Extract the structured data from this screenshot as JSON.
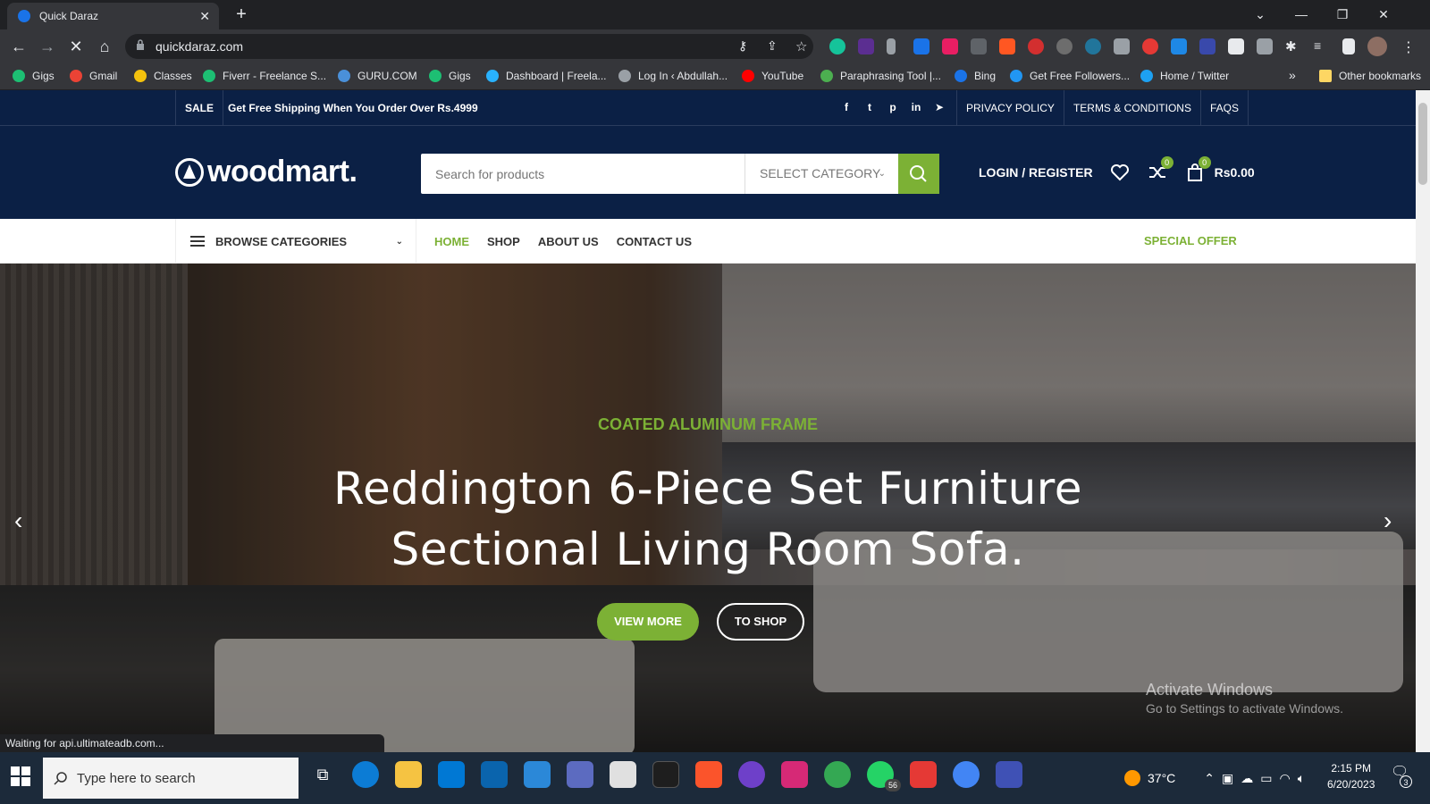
{
  "browser": {
    "tab_title": "Quick Daraz",
    "tab_close": "✕",
    "new_tab": "+",
    "url": "quickdaraz.com",
    "window_controls": [
      "⌄",
      "—",
      "❐",
      "✕"
    ],
    "nav": {
      "back": "←",
      "forward": "→",
      "reload": "✕",
      "home": "⌂"
    },
    "bookmarks": [
      {
        "label": "Gigs",
        "color": "#1dbf73"
      },
      {
        "label": "Gmail",
        "color": "#ea4335"
      },
      {
        "label": "Classes",
        "color": "#f4c20d"
      },
      {
        "label": "Fiverr - Freelance S...",
        "color": "#1dbf73"
      },
      {
        "label": "GURU.COM",
        "color": "#4a90d9"
      },
      {
        "label": "Gigs",
        "color": "#1dbf73"
      },
      {
        "label": "Dashboard | Freela...",
        "color": "#29b2fe"
      },
      {
        "label": "Log In ‹ Abdullah...",
        "color": "#9aa0a6"
      },
      {
        "label": "YouTube",
        "color": "#ff0000"
      },
      {
        "label": "Paraphrasing Tool |...",
        "color": "#4caf50"
      },
      {
        "label": "Bing",
        "color": "#1a73e8"
      },
      {
        "label": "Get Free Followers...",
        "color": "#2196f3"
      },
      {
        "label": "Home / Twitter",
        "color": "#1da1f2"
      }
    ],
    "bookmarks_more": "»",
    "other_bookmarks": "Other bookmarks",
    "status_text": "Waiting for api.ultimateadb.com..."
  },
  "site": {
    "topbar": {
      "sale_label": "SALE",
      "shipping_text": "Get Free Shipping When You Order Over Rs.4999",
      "social": [
        "f",
        "t",
        "p",
        "in",
        "➤"
      ],
      "links": [
        "PRIVACY POLICY",
        "TERMS & CONDITIONS",
        "FAQS"
      ]
    },
    "header": {
      "logo_text": "woodmart.",
      "search_placeholder": "Search for products",
      "category_select": "SELECT CATEGORY",
      "login_label": "LOGIN / REGISTER",
      "compare_count": "0",
      "cart_count": "0",
      "cart_total": "Rs0.00"
    },
    "nav": {
      "browse_label": "BROWSE CATEGORIES",
      "items": [
        "HOME",
        "SHOP",
        "ABOUT US",
        "CONTACT US"
      ],
      "special_offer": "SPECIAL OFFER"
    },
    "hero": {
      "eyebrow": "COATED ALUMINUM FRAME",
      "title_line1": "Reddington 6-Piece Set Furniture",
      "title_line2": "Sectional Living Room Sofa.",
      "btn_primary": "VIEW MORE",
      "btn_secondary": "TO SHOP",
      "prev_arrow": "‹",
      "next_arrow": "›"
    },
    "watermark": {
      "line1": "Activate Windows",
      "line2": "Go to Settings to activate Windows."
    }
  },
  "taskbar": {
    "search_placeholder": "Type here to search",
    "weather": "37°C",
    "time": "2:15 PM",
    "date": "6/20/2023",
    "notification_count": "3",
    "whatsapp_badge": "56"
  },
  "colors": {
    "brand_dark": "#0b2045",
    "accent_green": "#7cb135"
  }
}
